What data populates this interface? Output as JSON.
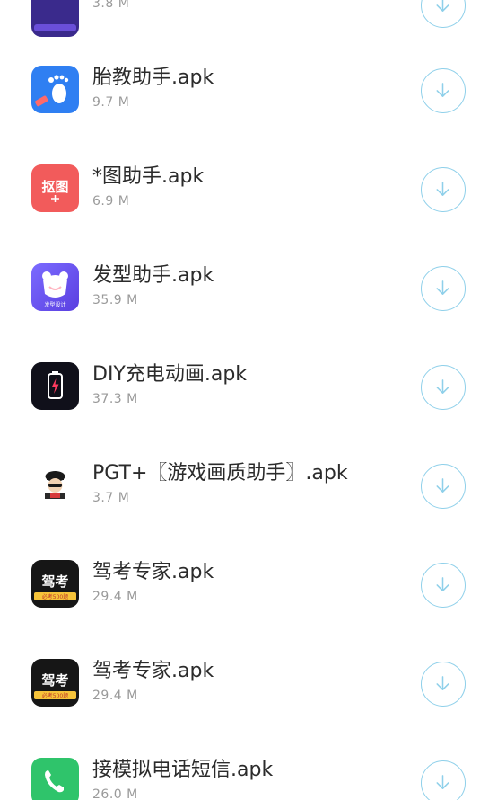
{
  "accent_color": "#8fd0ea",
  "download_icon": "download-arrow-icon",
  "apps": [
    {
      "name": "",
      "size": "3.8 M",
      "icon": "partial-app-icon"
    },
    {
      "name": "胎教助手.apk",
      "size": "9.7 M",
      "icon": "footprint-app-icon"
    },
    {
      "name": "*图助手.apk",
      "size": "6.9 M",
      "icon": "koutu-app-icon",
      "icon_text": "抠图"
    },
    {
      "name": "发型助手.apk",
      "size": "35.9 M",
      "icon": "bear-app-icon",
      "icon_text": "发型设计"
    },
    {
      "name": "DIY充电动画.apk",
      "size": "37.3 M",
      "icon": "battery-app-icon"
    },
    {
      "name": "PGT+〖游戏画质助手〗.apk",
      "size": "3.7 M",
      "icon": "character-app-icon"
    },
    {
      "name": "驾考专家.apk",
      "size": "29.4 M",
      "icon": "driving-exam-app-icon",
      "icon_text": "驾考",
      "icon_subtext": "必考500题"
    },
    {
      "name": "驾考专家.apk",
      "size": "29.4 M",
      "icon": "driving-exam-app-icon",
      "icon_text": "驾考",
      "icon_subtext": "必考500题"
    },
    {
      "name": "接模拟电话短信.apk",
      "size": "26.0 M",
      "icon": "phone-app-icon"
    }
  ]
}
